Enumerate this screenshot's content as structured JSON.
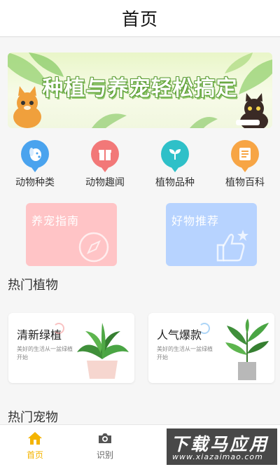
{
  "header": {
    "title": "首页"
  },
  "banner": {
    "text": "种植与养宠轻松搞定"
  },
  "categories": [
    {
      "label": "动物种类",
      "icon": "dog-icon",
      "color": "#4aa3ee"
    },
    {
      "label": "动物趣闻",
      "icon": "gift-icon",
      "color": "#f27878"
    },
    {
      "label": "植物品种",
      "icon": "sprout-icon",
      "color": "#2fc0c8"
    },
    {
      "label": "植物百科",
      "icon": "book-icon",
      "color": "#f7a545"
    }
  ],
  "guides": [
    {
      "title": "养宠指南",
      "icon": "compass-icon",
      "color": "#ffc4c6"
    },
    {
      "title": "好物推荐",
      "icon": "thumbs-up-icon",
      "color": "#b7d3ff"
    }
  ],
  "hot_plants": {
    "title": "热门植物",
    "items": [
      {
        "name": "清新绿植",
        "desc": "美好的生活从一盆绿植开始",
        "icon": "potted-plant-icon"
      },
      {
        "name": "人气爆款",
        "desc": "美好的生活从一盆绿植开始",
        "icon": "tall-plant-icon"
      }
    ]
  },
  "hot_pets": {
    "title": "热门宠物"
  },
  "tabbar": [
    {
      "label": "首页",
      "icon": "home-icon",
      "active": true
    },
    {
      "label": "识别",
      "icon": "camera-icon",
      "active": false
    }
  ],
  "watermark": {
    "main": "下载马应用",
    "site": "www.xiazaimao.com"
  },
  "colors": {
    "accent": "#f4b400"
  }
}
